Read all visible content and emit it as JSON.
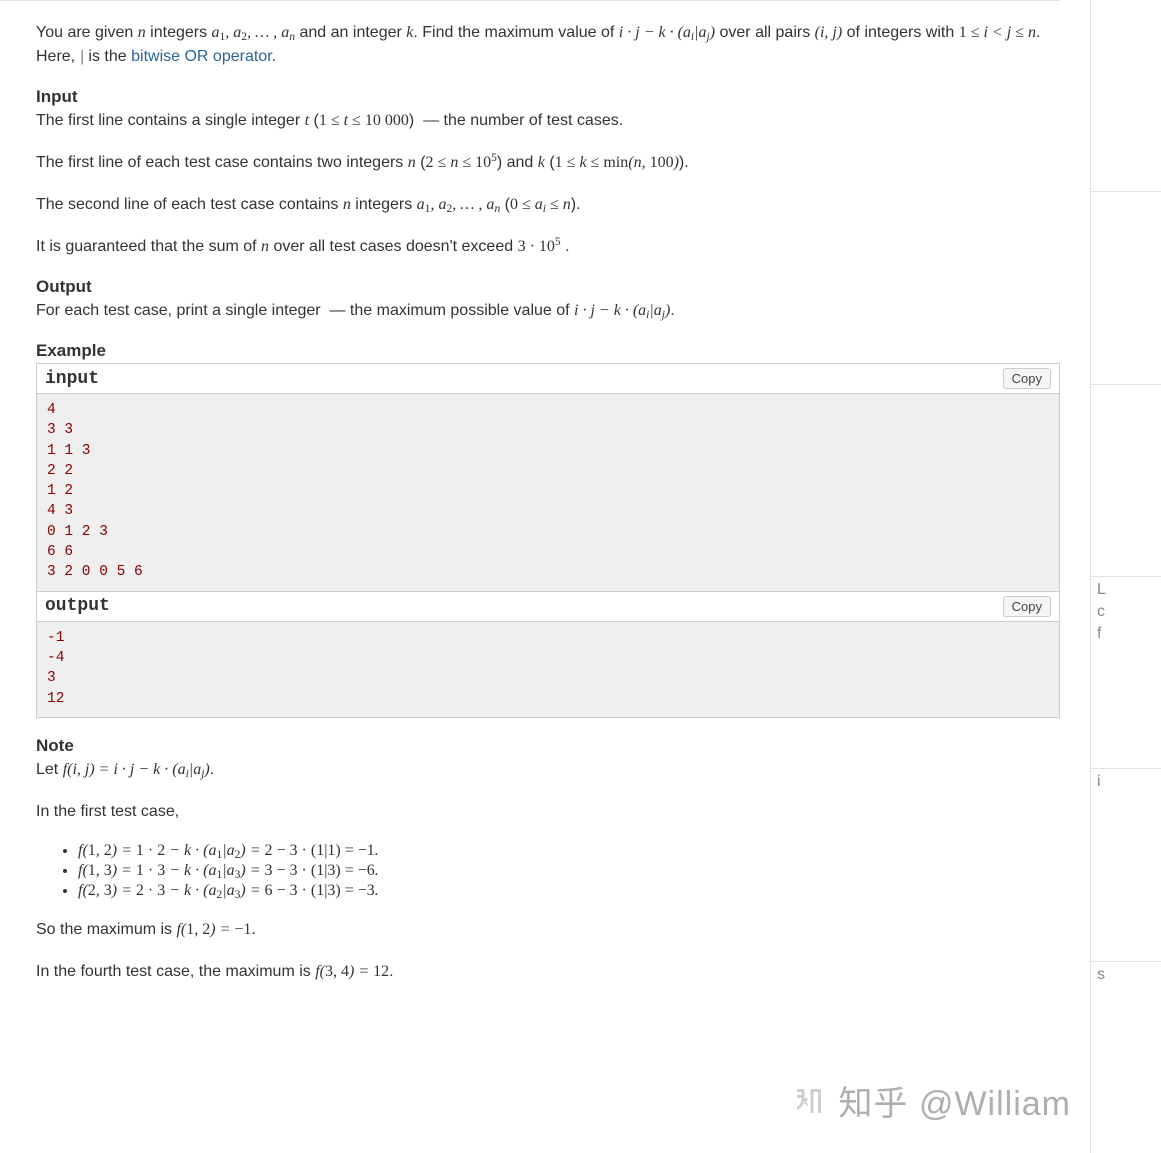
{
  "intro_html": "You are given <span class='math'>n</span> integers <span class='math'>a<span class='sub rm'>1</span>, a<span class='sub rm'>2</span>, … , a<span class='sub'>n</span></span> and an integer <span class='math'>k</span>. Find the maximum value of <span class='math'>i · j − k · (a<span class='sub'>i</span>|a<span class='sub'>j</span>)</span> over all pairs <span class='math'>(i, j)</span> of integers with <span class='math'><span class='rm'>1</span> ≤ i &lt; j ≤ n</span>. Here, <span class='math rm'>|</span> is the <a class='link' href='#' data-name='bitwise-or-link' data-interactable='true'>bitwise OR operator</a>.",
  "input_title": "Input",
  "input_p1_html": "The first line contains a single integer <span class='math'>t</span> (<span class='math'><span class='rm'>1</span> ≤ t ≤ <span class='rm'>10 000</span></span>) &nbsp;— the number of test cases.",
  "input_p2_html": "The first line of each test case contains two integers <span class='math'>n</span> (<span class='math'><span class='rm'>2</span> ≤ n ≤ <span class='rm'>10</span><span class='sup rm'>5</span></span>) and <span class='math'>k</span> (<span class='math'><span class='rm'>1</span> ≤ k ≤ <span class='rm'>min</span>(n, <span class='rm'>100</span>)</span>).",
  "input_p3_html": "The second line of each test case contains <span class='math'>n</span> integers <span class='math'>a<span class='sub rm'>1</span>, a<span class='sub rm'>2</span>, … , a<span class='sub'>n</span></span> (<span class='math'><span class='rm'>0</span> ≤ a<span class='sub'>i</span> ≤ n</span>).",
  "input_p4_html": "It is guaranteed that the sum of <span class='math'>n</span> over all test cases doesn't exceed <span class='math'><span class='rm'>3 · 10</span><span class='sup rm'>5</span></span> .",
  "output_title": "Output",
  "output_p_html": "For each test case, print a single integer &nbsp;— the maximum possible value of <span class='math'>i · j − k · (a<span class='sub'>i</span>|a<span class='sub'>j</span>)</span>.",
  "example_title": "Example",
  "input_label": "input",
  "output_label": "output",
  "copy_label": "Copy",
  "input_text": "4\n3 3\n1 1 3\n2 2\n1 2\n4 3\n0 1 2 3\n6 6\n3 2 0 0 5 6",
  "output_text": "-1\n-4\n3\n12",
  "note_title": "Note",
  "note_let_html": "Let <span class='math'>f(i, j) = i · j − k · (a<span class='sub'>i</span>|a<span class='sub'>j</span>)</span>.",
  "note_first": "In the first test case,",
  "bullets_html": [
    "<span class='math'>f(<span class='rm'>1</span>, <span class='rm'>2</span>) = <span class='rm'>1 · 2</span> − k · (a<span class='sub rm'>1</span>|a<span class='sub rm'>2</span>) = <span class='rm'>2 − 3 · (1|1) = −1</span>.</span>",
    "<span class='math'>f(<span class='rm'>1</span>, <span class='rm'>3</span>) = <span class='rm'>1 · 3</span> − k · (a<span class='sub rm'>1</span>|a<span class='sub rm'>3</span>) = <span class='rm'>3 − 3 · (1|3) = −6</span>.</span>",
    "<span class='math'>f(<span class='rm'>2</span>, <span class='rm'>3</span>) = <span class='rm'>2 · 3</span> − k · (a<span class='sub rm'>2</span>|a<span class='sub rm'>3</span>) = <span class='rm'>6 − 3 · (1|3) = −3</span>.</span>"
  ],
  "note_so_html": "So the maximum is <span class='math'>f(<span class='rm'>1</span>, <span class='rm'>2</span>) = <span class='rm'>−1</span></span>.",
  "note_fourth_html": "In the fourth test case, the maximum is <span class='math'>f(<span class='rm'>3</span>, <span class='rm'>4</span>) = <span class='rm'>12</span></span>.",
  "watermark": "知乎 @William",
  "edge_letters": [
    "",
    "",
    "L",
    "c",
    "f",
    "i",
    "s"
  ]
}
